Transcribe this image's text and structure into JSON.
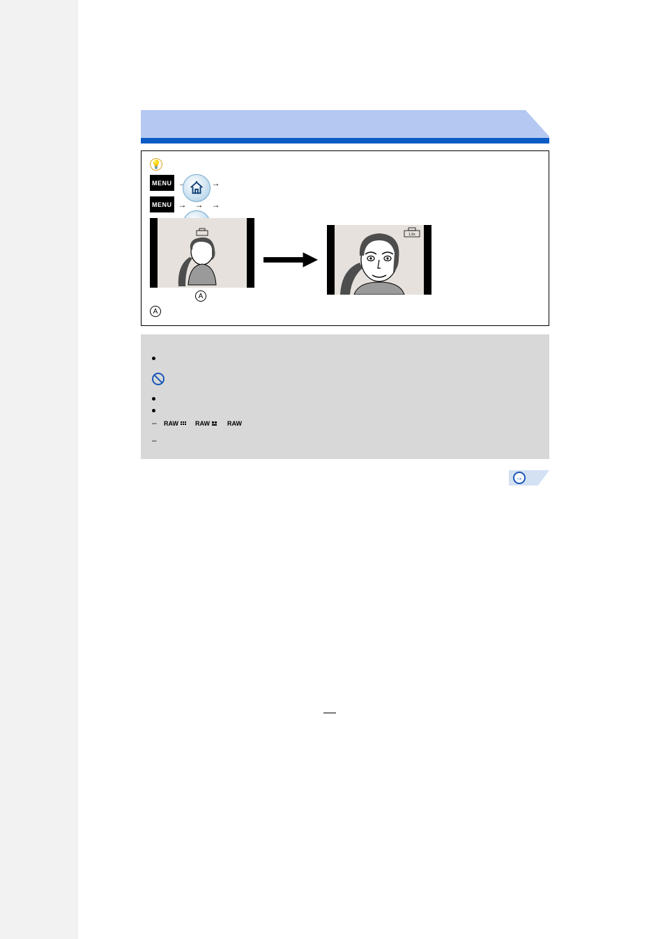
{
  "banner": {
    "title": ""
  },
  "tip": {
    "path1": {
      "p1": "",
      "p2": "",
      "p3": "",
      "p4": ""
    },
    "path2": {
      "p1": "",
      "p2": "",
      "p3": "",
      "p4": "",
      "p5": ""
    },
    "label_a": "A",
    "legend_a": "A",
    "legend_text": ""
  },
  "notes": {
    "intro_line1": "",
    "intro_line2": "",
    "bullet1": "",
    "bullet2": "",
    "bullet3_prefix": "",
    "bullet3_suffix": "",
    "bullet4": ""
  },
  "raw_labels": {
    "r1": "RAW",
    "r2": "RAW",
    "r3": "RAW"
  },
  "page_number": ""
}
